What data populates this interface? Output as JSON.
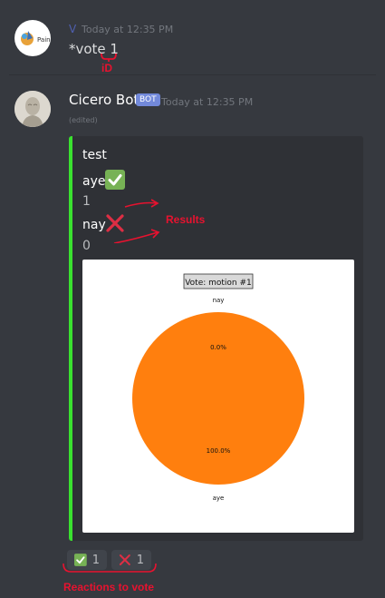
{
  "message1": {
    "author_initial": "V",
    "avatar_text": "Pain",
    "timestamp": "Today at 12:35 PM",
    "content": "*vote 1"
  },
  "message2": {
    "author": "Cicero Bot",
    "badge": "BOT",
    "timestamp": "Today at 12:35 PM",
    "edited": "(edited)",
    "embed": {
      "title": "test",
      "fields": [
        {
          "name": "aye",
          "icon": "check-icon",
          "value": "1"
        },
        {
          "name": "nay",
          "icon": "x-icon",
          "value": "0"
        }
      ],
      "accent_color": "#3ae22f"
    }
  },
  "chart_data": {
    "type": "pie",
    "title": "Vote: motion #1",
    "slices": [
      {
        "label": "aye",
        "value": 100.0,
        "pct_label": "100.0%",
        "color": "#ff7f0e"
      },
      {
        "label": "nay",
        "value": 0.0,
        "pct_label": "0.0%",
        "color": "#1f77b4"
      }
    ]
  },
  "reactions": [
    {
      "emoji": "check-icon",
      "count": "1"
    },
    {
      "emoji": "x-icon",
      "count": "1"
    }
  ],
  "annotations": {
    "id_label": "iD",
    "results_label": "Results",
    "reactions_label": "Reactions to vote"
  },
  "colors": {
    "background": "#36393f",
    "embed_bg": "#2f3136",
    "bot_badge": "#7289da",
    "check_green": "#77b255",
    "cross_red": "#dd2e44",
    "annotation_red": "#e8122f"
  }
}
